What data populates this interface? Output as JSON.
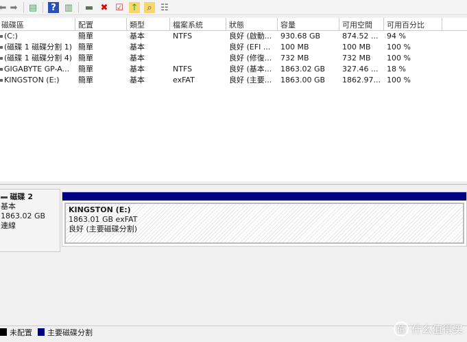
{
  "toolbar": {
    "icons": [
      "back-icon",
      "forward-icon",
      "console-tree-icon",
      "help-icon",
      "action-pane-icon",
      "connect-disk-icon",
      "delete-icon",
      "properties-check-icon",
      "folder-up-icon",
      "folder-search-icon",
      "settings-list-icon"
    ]
  },
  "table": {
    "headers": [
      "磁碟區",
      "配置",
      "類型",
      "檔案系統",
      "狀態",
      "容量",
      "可用空間",
      "可用百分比"
    ],
    "rows": [
      [
        "(C:)",
        "簡單",
        "基本",
        "NTFS",
        "良好 (啟動...",
        "930.68 GB",
        "874.52 ...",
        "94 %"
      ],
      [
        "(磁碟 1 磁碟分割 1)",
        "簡單",
        "基本",
        "",
        "良好 (EFI ...",
        "100 MB",
        "100 MB",
        "100 %"
      ],
      [
        "(磁碟 1 磁碟分割 4)",
        "簡單",
        "基本",
        "",
        "良好 (修復...",
        "732 MB",
        "732 MB",
        "100 %"
      ],
      [
        "GIGABYTE GP-A...",
        "簡單",
        "基本",
        "NTFS",
        "良好 (基本...",
        "1863.02 GB",
        "327.46 ...",
        "18 %"
      ],
      [
        "KINGSTON (E:)",
        "簡單",
        "基本",
        "exFAT",
        "良好 (主要...",
        "1863.00 GB",
        "1862.97...",
        "100 %"
      ]
    ]
  },
  "disk": {
    "name": "磁碟 2",
    "type": "基本",
    "size": "1863.02 GB",
    "status": "連線"
  },
  "partition": {
    "name": "KINGSTON  (E:)",
    "size_fs": "1863.01 GB exFAT",
    "status": "良好 (主要磁碟分割)",
    "color": "#000080"
  },
  "legend": [
    {
      "label": "未配置",
      "color": "#000000"
    },
    {
      "label": "主要磁碟分割",
      "color": "#000080"
    }
  ],
  "watermark": {
    "badge": "值",
    "text": "什么值得买"
  }
}
